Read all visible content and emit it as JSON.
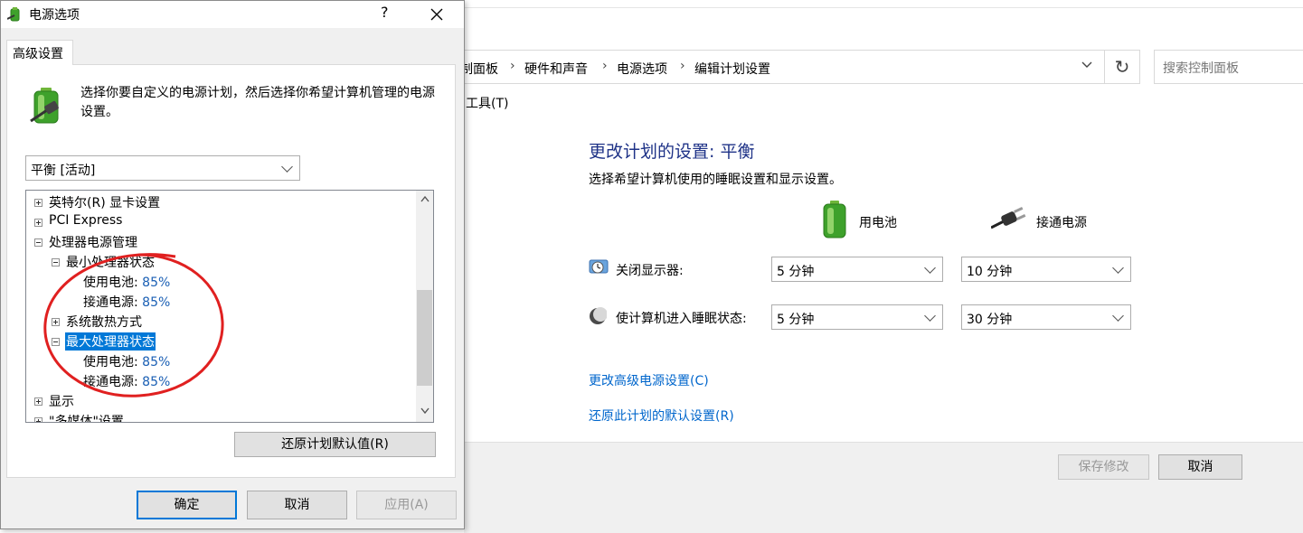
{
  "background_window": {
    "breadcrumb": [
      "制面板",
      "硬件和声音",
      "电源选项",
      "编辑计划设置"
    ],
    "search_placeholder": "搜索控制面板",
    "menu_tools": "工具(T)",
    "plan_title": "更改计划的设置: 平衡",
    "plan_desc": "选择希望计算机使用的睡眠设置和显示设置。",
    "on_battery": "用电池",
    "plugged_in": "接通电源",
    "rows": [
      {
        "label": "关闭显示器:",
        "battery": "5 分钟",
        "plugged": "10 分钟"
      },
      {
        "label": "使计算机进入睡眠状态:",
        "battery": "5 分钟",
        "plugged": "30 分钟"
      }
    ],
    "link_advanced": "更改高级电源设置(C)",
    "link_restore": "还原此计划的默认设置(R)",
    "save_button": "保存修改",
    "cancel_button": "取消"
  },
  "dialog": {
    "title": "电源选项",
    "help": "?",
    "close": "✕",
    "tab": "高级设置",
    "intro": "选择你要自定义的电源计划，然后选择你希望计算机管理的电源设置。",
    "plan_selected": "平衡 [活动]",
    "tree": {
      "intel_graphics": "英特尔(R) 显卡设置",
      "pci_express": "PCI Express",
      "processor_power": "处理器电源管理",
      "min_state": "最小处理器状态",
      "min_battery_label": "使用电池:",
      "min_battery_value": "85%",
      "min_plugged_label": "接通电源:",
      "min_plugged_value": "85%",
      "cooling_policy": "系统散热方式",
      "max_state": "最大处理器状态",
      "max_battery_label": "使用电池:",
      "max_battery_value": "85%",
      "max_plugged_label": "接通电源:",
      "max_plugged_value": "85%",
      "display": "显示",
      "multimedia": "\"多媒体\"设置"
    },
    "restore_defaults": "还原计划默认值(R)",
    "ok": "确定",
    "cancel": "取消",
    "apply": "应用(A)"
  },
  "colors": {
    "link": "#0066cc",
    "title": "#1e3287",
    "selection": "#0078d7",
    "annotation": "#e02020"
  }
}
